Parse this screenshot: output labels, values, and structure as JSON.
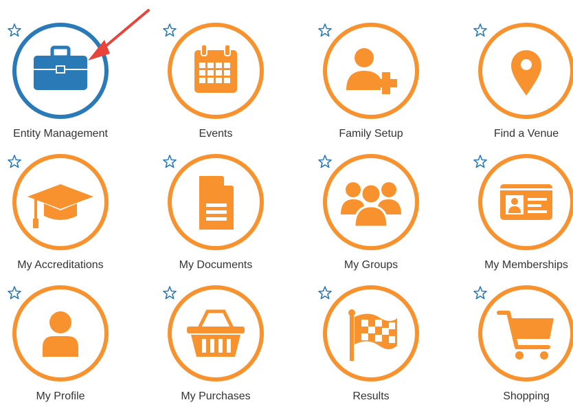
{
  "colors": {
    "accent": "#f7922e",
    "highlight": "#2a7ab8",
    "star": "#2a7ab8",
    "arrow": "#e8443b"
  },
  "tiles": [
    {
      "label": "Entity Management",
      "icon": "briefcase-icon",
      "highlighted": true
    },
    {
      "label": "Events",
      "icon": "calendar-icon"
    },
    {
      "label": "Family Setup",
      "icon": "add-user-icon"
    },
    {
      "label": "Find a Venue",
      "icon": "map-pin-icon"
    },
    {
      "label": "My Accreditations",
      "icon": "graduation-cap-icon"
    },
    {
      "label": "My Documents",
      "icon": "document-icon"
    },
    {
      "label": "My Groups",
      "icon": "group-icon"
    },
    {
      "label": "My Memberships",
      "icon": "id-card-icon"
    },
    {
      "label": "My Profile",
      "icon": "user-icon"
    },
    {
      "label": "My Purchases",
      "icon": "basket-icon"
    },
    {
      "label": "Results",
      "icon": "checkered-flag-icon"
    },
    {
      "label": "Shopping",
      "icon": "shopping-cart-icon"
    }
  ]
}
